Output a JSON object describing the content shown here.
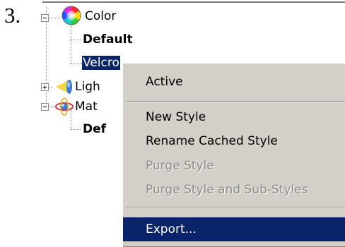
{
  "step_number": "3.",
  "tree": {
    "color_node": {
      "label": "Color",
      "icon": "color-wheel-icon"
    },
    "default_item": {
      "label": "Default"
    },
    "velcro_item": {
      "label": "Velcro"
    },
    "lights_node": {
      "label": "Ligh",
      "icon": "light-cone-icon"
    },
    "materials_node": {
      "label": "Mat",
      "icon": "material-atom-icon"
    },
    "default_material_item": {
      "label": "Def"
    }
  },
  "context_menu": {
    "active": "Active",
    "new_style": "New Style",
    "rename_cached_style": "Rename Cached Style",
    "purge_style": "Purge Style",
    "purge_style_and_substyles": "Purge Style and Sub-Styles",
    "export": "Export..."
  },
  "colors": {
    "selection": "#0a246a",
    "menu_background": "#d4d0c8",
    "disabled_text": "#8c8c8c"
  }
}
